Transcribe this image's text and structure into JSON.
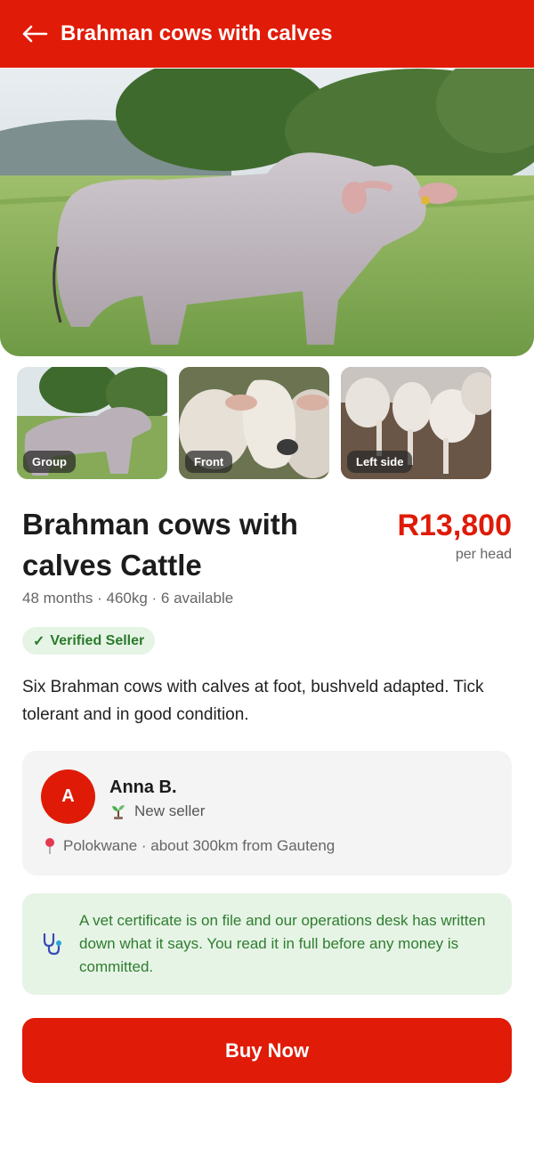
{
  "header": {
    "title": "Brahman cows with calves"
  },
  "photos": [
    {
      "label": "Group"
    },
    {
      "label": "Front"
    },
    {
      "label": "Left side"
    }
  ],
  "listing": {
    "title": "Brahman cows with calves Cattle",
    "price": "R13,800",
    "price_unit": "per head",
    "meta": "48 months · 460kg · 6 available",
    "badge": "Verified Seller",
    "description": "Six Brahman cows with calves at foot, bushveld adapted. Tick tolerant and in good condition."
  },
  "seller": {
    "initial": "A",
    "name": "Anna B.",
    "status": "New seller",
    "location": "Polokwane · about 300km from Gauteng"
  },
  "vet_note": "A vet certificate is on file and our operations desk has written down what it says. You read it in full before any money is committed.",
  "actions": {
    "buy_label": "Buy Now"
  },
  "colors": {
    "brand": "#e01b07",
    "success": "#2f7d2f",
    "success_bg": "#e6f4e6"
  },
  "icons": [
    "back-arrow-icon",
    "checkmark-icon",
    "seedling-icon",
    "location-pin-icon",
    "stethoscope-icon"
  ]
}
